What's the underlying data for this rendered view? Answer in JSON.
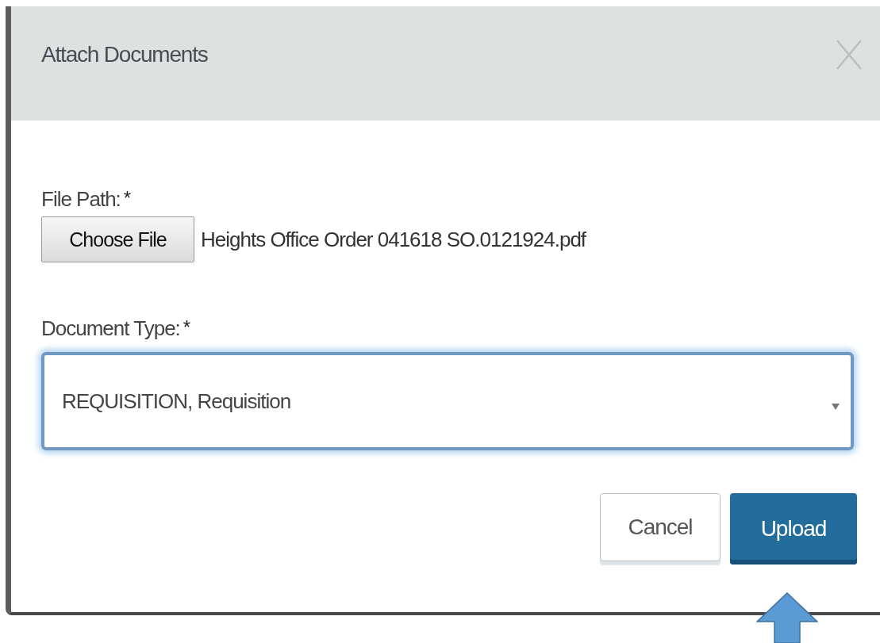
{
  "dialog": {
    "title": "Attach Documents"
  },
  "file_path": {
    "label": "File Path:",
    "required_mark": "*",
    "button": "Choose File",
    "file_name": "Heights Office Order 041618 SO.0121924.pdf"
  },
  "document_type": {
    "label": "Document Type:",
    "required_mark": "*",
    "value": "REQUISITION, Requisition",
    "focused": true
  },
  "buttons": [
    {
      "label": "Cancel",
      "kind": "default"
    },
    {
      "label": "Upload",
      "kind": "primary"
    }
  ]
}
